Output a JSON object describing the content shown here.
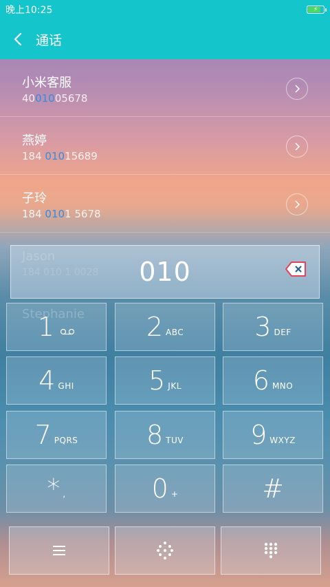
{
  "status": {
    "time": "晚上10:25"
  },
  "header": {
    "title": "通话"
  },
  "contacts": [
    {
      "name": "小米客服",
      "num_pre": "40",
      "num_hl": "010",
      "num_post": "05678"
    },
    {
      "name": "燕婷",
      "num_pre": "184 ",
      "num_hl": "010",
      "num_post": "15689"
    },
    {
      "name": "子玲",
      "num_pre": "184 ",
      "num_hl": "010",
      "num_post": "1 5678"
    }
  ],
  "hidden_contacts": [
    {
      "name": "Jason",
      "num": "184 010 1 0028"
    },
    {
      "name": "Stephanie",
      "num": ""
    },
    {
      "name": "",
      "num": ""
    },
    {
      "name": "",
      "num": ""
    }
  ],
  "dialer": {
    "input": "010",
    "keys": [
      {
        "digit": "1",
        "letters": ""
      },
      {
        "digit": "2",
        "letters": "ABC"
      },
      {
        "digit": "3",
        "letters": "DEF"
      },
      {
        "digit": "4",
        "letters": "GHI"
      },
      {
        "digit": "5",
        "letters": "JKL"
      },
      {
        "digit": "6",
        "letters": "MNO"
      },
      {
        "digit": "7",
        "letters": "PQRS"
      },
      {
        "digit": "8",
        "letters": "TUV"
      },
      {
        "digit": "9",
        "letters": "WXYZ"
      },
      {
        "digit": "*",
        "letters": ","
      },
      {
        "digit": "0",
        "letters": "+"
      },
      {
        "digit": "#",
        "letters": ""
      }
    ]
  },
  "colors": {
    "accent": "#14c6cc",
    "highlight": "#2f8de4",
    "delete": "#e0435a"
  },
  "icons": [
    "back-icon",
    "chevron-right-icon",
    "delete-icon",
    "voicemail-icon",
    "menu-icon",
    "dialpad-dots-icon",
    "dialpad-grid-icon"
  ]
}
